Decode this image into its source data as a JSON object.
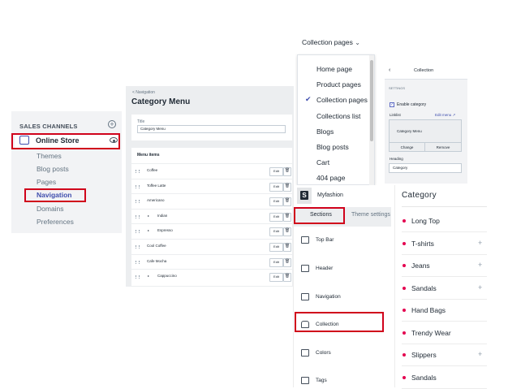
{
  "sales_channels": {
    "header": "SALES CHANNELS",
    "store_label": "Online Store",
    "items": [
      {
        "label": "Themes"
      },
      {
        "label": "Blog posts"
      },
      {
        "label": "Pages"
      },
      {
        "label": "Navigation"
      },
      {
        "label": "Domains"
      },
      {
        "label": "Preferences"
      }
    ]
  },
  "category_menu": {
    "back_label": "< Navigation",
    "title": "Category Menu",
    "title_field_label": "Title",
    "title_field_value": "Category Menu",
    "menu_items_label": "Menu items",
    "edit_label": "Edit",
    "delete_icon": "trash-icon",
    "items": [
      {
        "label": "Coffee",
        "nested": false
      },
      {
        "label": "Toffee Latte",
        "nested": false
      },
      {
        "label": "Americano",
        "nested": false
      },
      {
        "label": "Indian",
        "nested": true
      },
      {
        "label": "Espresso",
        "nested": true
      },
      {
        "label": "Cool Coffee",
        "nested": false
      },
      {
        "label": "Cafe Mocha",
        "nested": false
      },
      {
        "label": "Cappuccino",
        "nested": true
      }
    ]
  },
  "page_selector": {
    "label": "Collection pages",
    "options": [
      {
        "label": "Home page"
      },
      {
        "label": "Product pages"
      },
      {
        "label": "Collection pages"
      },
      {
        "label": "Collections list"
      },
      {
        "label": "Blogs"
      },
      {
        "label": "Blog posts"
      },
      {
        "label": "Cart"
      },
      {
        "label": "404 page"
      }
    ]
  },
  "collection_settings": {
    "back_glyph": "‹",
    "title": "Collection",
    "section_label": "SETTINGS",
    "checkbox_label": "Enable category",
    "linklist_label": "Linklist",
    "edit_menu_label": "Edit menu",
    "menu_name": "Category Menu",
    "change_label": "Change",
    "remove_label": "Remove",
    "heading_label": "Heading",
    "heading_value": "Category"
  },
  "theme_sections": {
    "shop_name": "Myfashion",
    "tabs": [
      {
        "label": "Sections"
      },
      {
        "label": "Theme settings"
      }
    ],
    "items": [
      {
        "label": "Top Bar"
      },
      {
        "label": "Header"
      },
      {
        "label": "Navigation"
      },
      {
        "label": "Collection"
      },
      {
        "label": "Colors"
      },
      {
        "label": "Tags"
      }
    ]
  },
  "category_sidebar": {
    "title": "Category",
    "items": [
      {
        "label": "Long Top",
        "expandable": false
      },
      {
        "label": "T-shirts",
        "expandable": true
      },
      {
        "label": "Jeans",
        "expandable": true
      },
      {
        "label": "Sandals",
        "expandable": true
      },
      {
        "label": "Hand Bags",
        "expandable": false
      },
      {
        "label": "Trendy Wear",
        "expandable": false
      },
      {
        "label": "Slippers",
        "expandable": true
      },
      {
        "label": "Sandals",
        "expandable": false
      }
    ]
  }
}
